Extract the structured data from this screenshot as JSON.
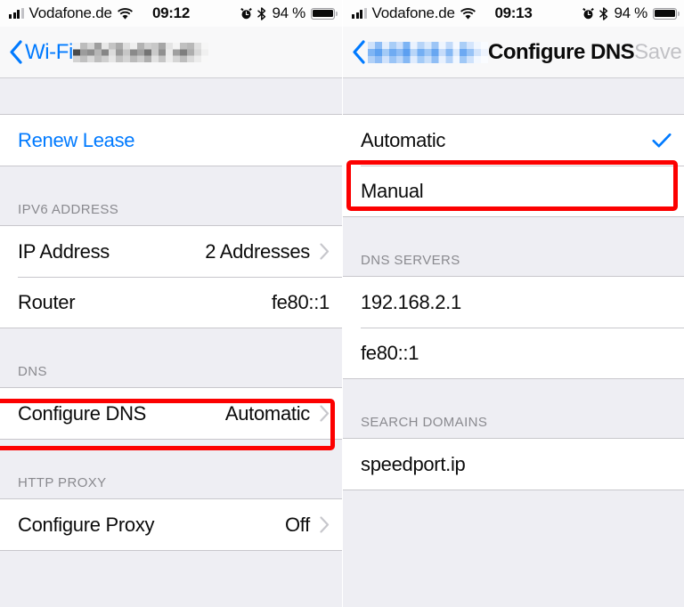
{
  "left": {
    "status_bar": {
      "carrier": "Vodafone.de",
      "time": "09:12",
      "battery_percent": "94 %",
      "signal_bars_filled": 3,
      "signal_bars_total": 4,
      "icons": [
        "signal-bars-icon",
        "wifi-icon",
        "alarm-icon",
        "bluetooth-icon",
        "battery-icon"
      ]
    },
    "nav": {
      "back_label": "Wi-Fi",
      "title_redacted": true,
      "title_redaction_color": "#b5b5b5"
    },
    "groups": [
      {
        "header": "",
        "rows": [
          {
            "title": "Renew Lease",
            "value": "",
            "style": "link",
            "accessory": "none"
          }
        ]
      },
      {
        "header": "IPV6 ADDRESS",
        "rows": [
          {
            "title": "IP Address",
            "value": "2 Addresses",
            "style": "normal",
            "accessory": "chevron"
          },
          {
            "title": "Router",
            "value": "fe80::1",
            "style": "normal",
            "accessory": "none"
          }
        ]
      },
      {
        "header": "DNS",
        "rows": [
          {
            "title": "Configure DNS",
            "value": "Automatic",
            "style": "normal",
            "accessory": "chevron",
            "highlighted": true
          }
        ]
      },
      {
        "header": "HTTP PROXY",
        "rows": [
          {
            "title": "Configure Proxy",
            "value": "Off",
            "style": "normal",
            "accessory": "chevron"
          }
        ]
      }
    ]
  },
  "right": {
    "status_bar": {
      "carrier": "Vodafone.de",
      "time": "09:13",
      "battery_percent": "94 %",
      "signal_bars_filled": 3,
      "signal_bars_total": 4,
      "icons": [
        "signal-bars-icon",
        "wifi-icon",
        "alarm-icon",
        "bluetooth-icon",
        "battery-icon"
      ]
    },
    "nav": {
      "back_label_redacted": true,
      "back_redaction_color": "#a9cbf7",
      "title": "Configure DNS",
      "save_label": "Save",
      "save_enabled": false
    },
    "groups": [
      {
        "header": "",
        "rows": [
          {
            "title": "Automatic",
            "value": "",
            "style": "normal",
            "accessory": "checkmark",
            "selected": true
          },
          {
            "title": "Manual",
            "value": "",
            "style": "normal",
            "accessory": "none",
            "highlighted": true
          }
        ]
      },
      {
        "header": "DNS SERVERS",
        "rows": [
          {
            "title": "192.168.2.1",
            "value": "",
            "style": "normal",
            "accessory": "none"
          },
          {
            "title": "fe80::1",
            "value": "",
            "style": "normal",
            "accessory": "none"
          }
        ]
      },
      {
        "header": "SEARCH DOMAINS",
        "rows": [
          {
            "title": "speedport.ip",
            "value": "",
            "style": "normal",
            "accessory": "none"
          }
        ]
      }
    ]
  },
  "annotations": {
    "highlight_color": "#fc0000",
    "boxes": [
      {
        "target": "left.configure-dns-row"
      },
      {
        "target": "right.manual-row"
      }
    ]
  }
}
